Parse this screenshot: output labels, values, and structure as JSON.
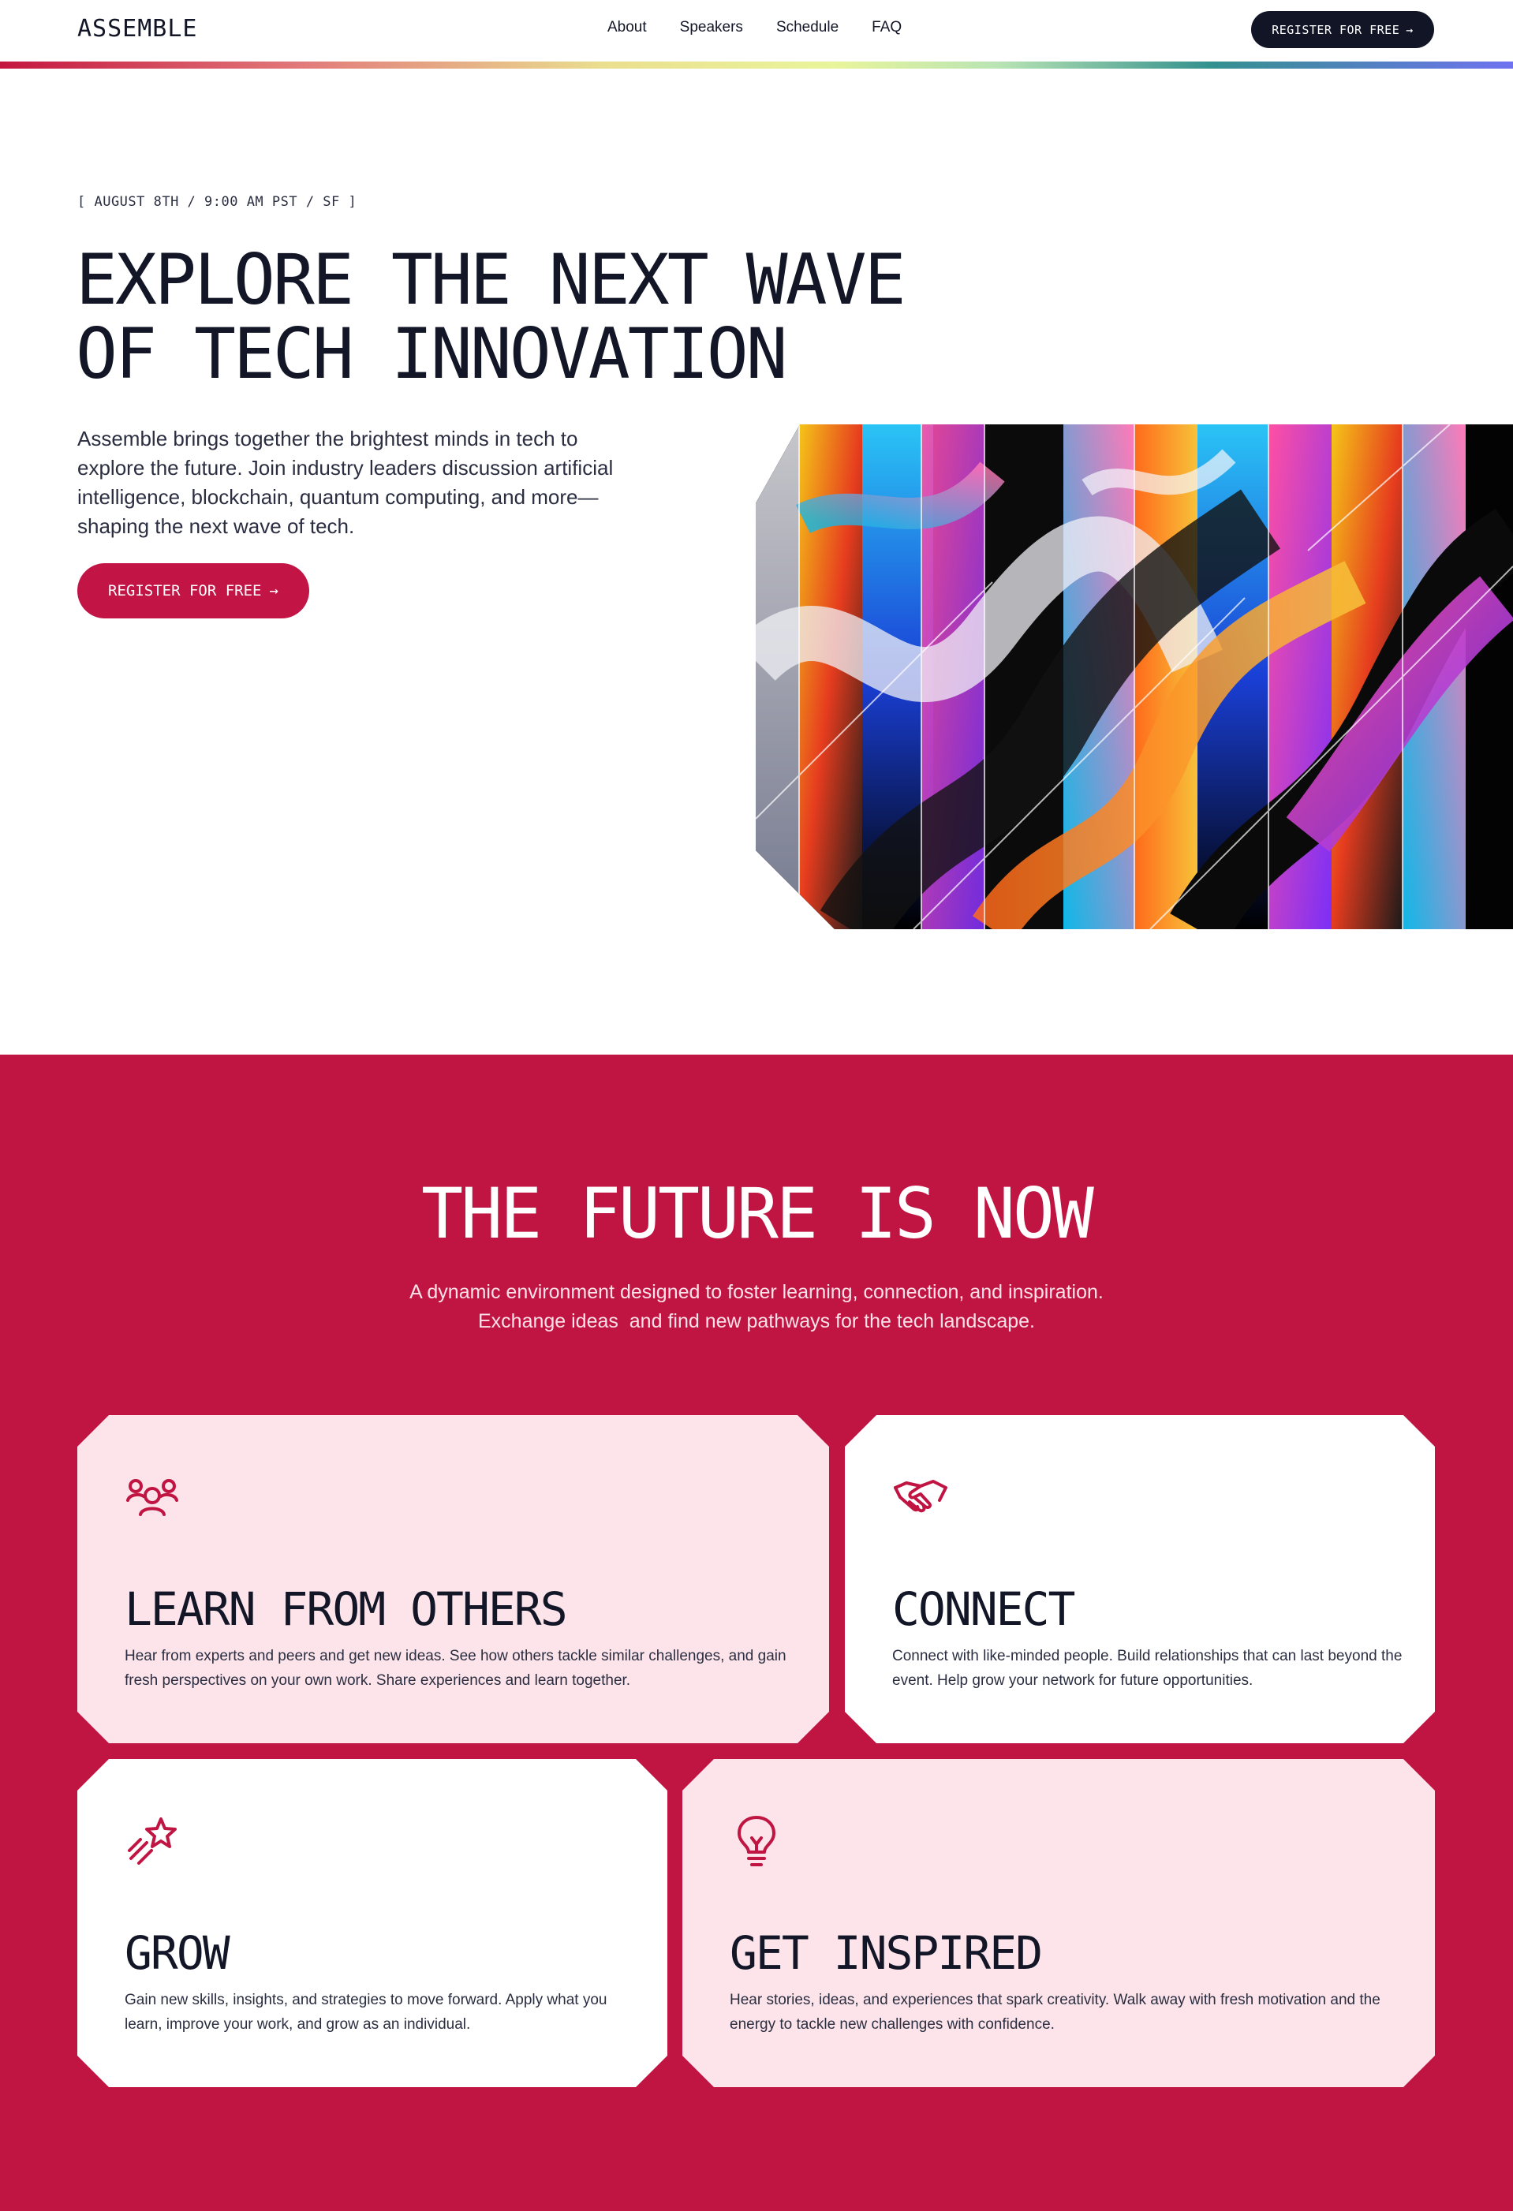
{
  "nav": {
    "logo": "ASSEMBLE",
    "links": [
      "About",
      "Speakers",
      "Schedule",
      "FAQ"
    ],
    "register_label": "REGISTER FOR FREE",
    "arrow": "→"
  },
  "hero": {
    "date": "[ AUGUST 8TH / 9:00 AM PST / SF ]",
    "title_line1": "EXPLORE THE NEXT WAVE",
    "title_line2": "OF TECH INNOVATION",
    "description": "Assemble brings together the brightest minds in tech to explore the future. Join industry leaders discussion artificial intelligence, blockchain, quantum computing, and more—shaping the next wave of tech.",
    "register_label": "REGISTER FOR FREE",
    "arrow": "→"
  },
  "future": {
    "title": "THE FUTURE IS NOW",
    "subtitle_line1": "A dynamic environment designed to foster learning, connection, and inspiration.",
    "subtitle_line2": "Exchange ideas  and find new pathways for the tech landscape.",
    "cards": [
      {
        "icon": "people-icon",
        "title": "LEARN FROM OTHERS",
        "text": "Hear from experts and peers and get new ideas. See how others tackle similar challenges, and gain fresh perspectives on your own work. Share experiences and learn together."
      },
      {
        "icon": "handshake-icon",
        "title": "CONNECT",
        "text": "Connect with like-minded people. Build relationships that can last beyond the event. Help grow your network for future opportunities."
      },
      {
        "icon": "shooting-star-icon",
        "title": "GROW",
        "text": "Gain new skills, insights, and strategies to move forward. Apply what you learn, improve your work, and grow as an individual."
      },
      {
        "icon": "lightbulb-icon",
        "title": "GET INSPIRED",
        "text": "Hear stories, ideas, and experiences that spark creativity. Walk away with fresh motivation and the energy to tackle new challenges with confidence."
      }
    ]
  },
  "colors": {
    "brand": "#c01542",
    "dark": "#111526",
    "card_pink": "#fde4ea"
  }
}
